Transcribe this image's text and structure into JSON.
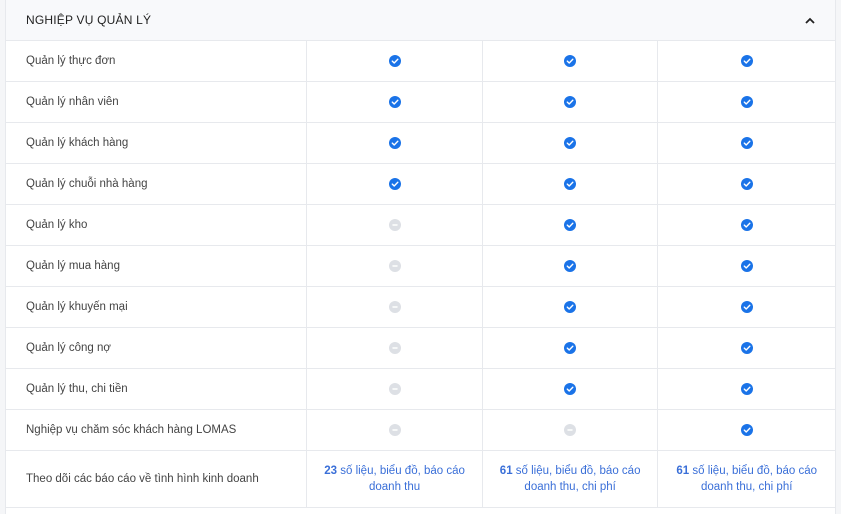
{
  "section": {
    "title": "NGHIỆP VỤ QUẢN LÝ",
    "collapse_icon": "chevron-up-icon"
  },
  "colors": {
    "check": "#1a73e8",
    "unavailable": "#dde0e5",
    "link_text": "#3a6fd8"
  },
  "rows": [
    {
      "label": "Quản lý thực đơn",
      "plans": [
        "check",
        "check",
        "check"
      ]
    },
    {
      "label": "Quản lý nhân viên",
      "plans": [
        "check",
        "check",
        "check"
      ]
    },
    {
      "label": "Quản lý khách hàng",
      "plans": [
        "check",
        "check",
        "check"
      ]
    },
    {
      "label": "Quản lý chuỗi nhà hàng",
      "plans": [
        "check",
        "check",
        "check"
      ]
    },
    {
      "label": "Quản lý kho",
      "plans": [
        "none",
        "check",
        "check"
      ]
    },
    {
      "label": "Quản lý mua hàng",
      "plans": [
        "none",
        "check",
        "check"
      ]
    },
    {
      "label": "Quản lý khuyến mại",
      "plans": [
        "none",
        "check",
        "check"
      ]
    },
    {
      "label": "Quản lý công nợ",
      "plans": [
        "none",
        "check",
        "check"
      ]
    },
    {
      "label": "Quản lý thu, chi tiền",
      "plans": [
        "none",
        "check",
        "check"
      ]
    },
    {
      "label": "Nghiệp vụ chăm sóc khách hàng LOMAS",
      "plans": [
        "none",
        "none",
        "check"
      ]
    }
  ],
  "report_row": {
    "label": "Theo dõi các báo cáo về tình hình kinh doanh",
    "plans": [
      {
        "count": "23",
        "text": " số liệu, biểu đồ, báo cáo doanh thu"
      },
      {
        "count": "61",
        "text": " số liệu, biểu đồ, báo cáo doanh thu, chi phí"
      },
      {
        "count": "61",
        "text": " số liệu, biểu đồ, báo cáo doanh thu, chi phí"
      }
    ]
  }
}
